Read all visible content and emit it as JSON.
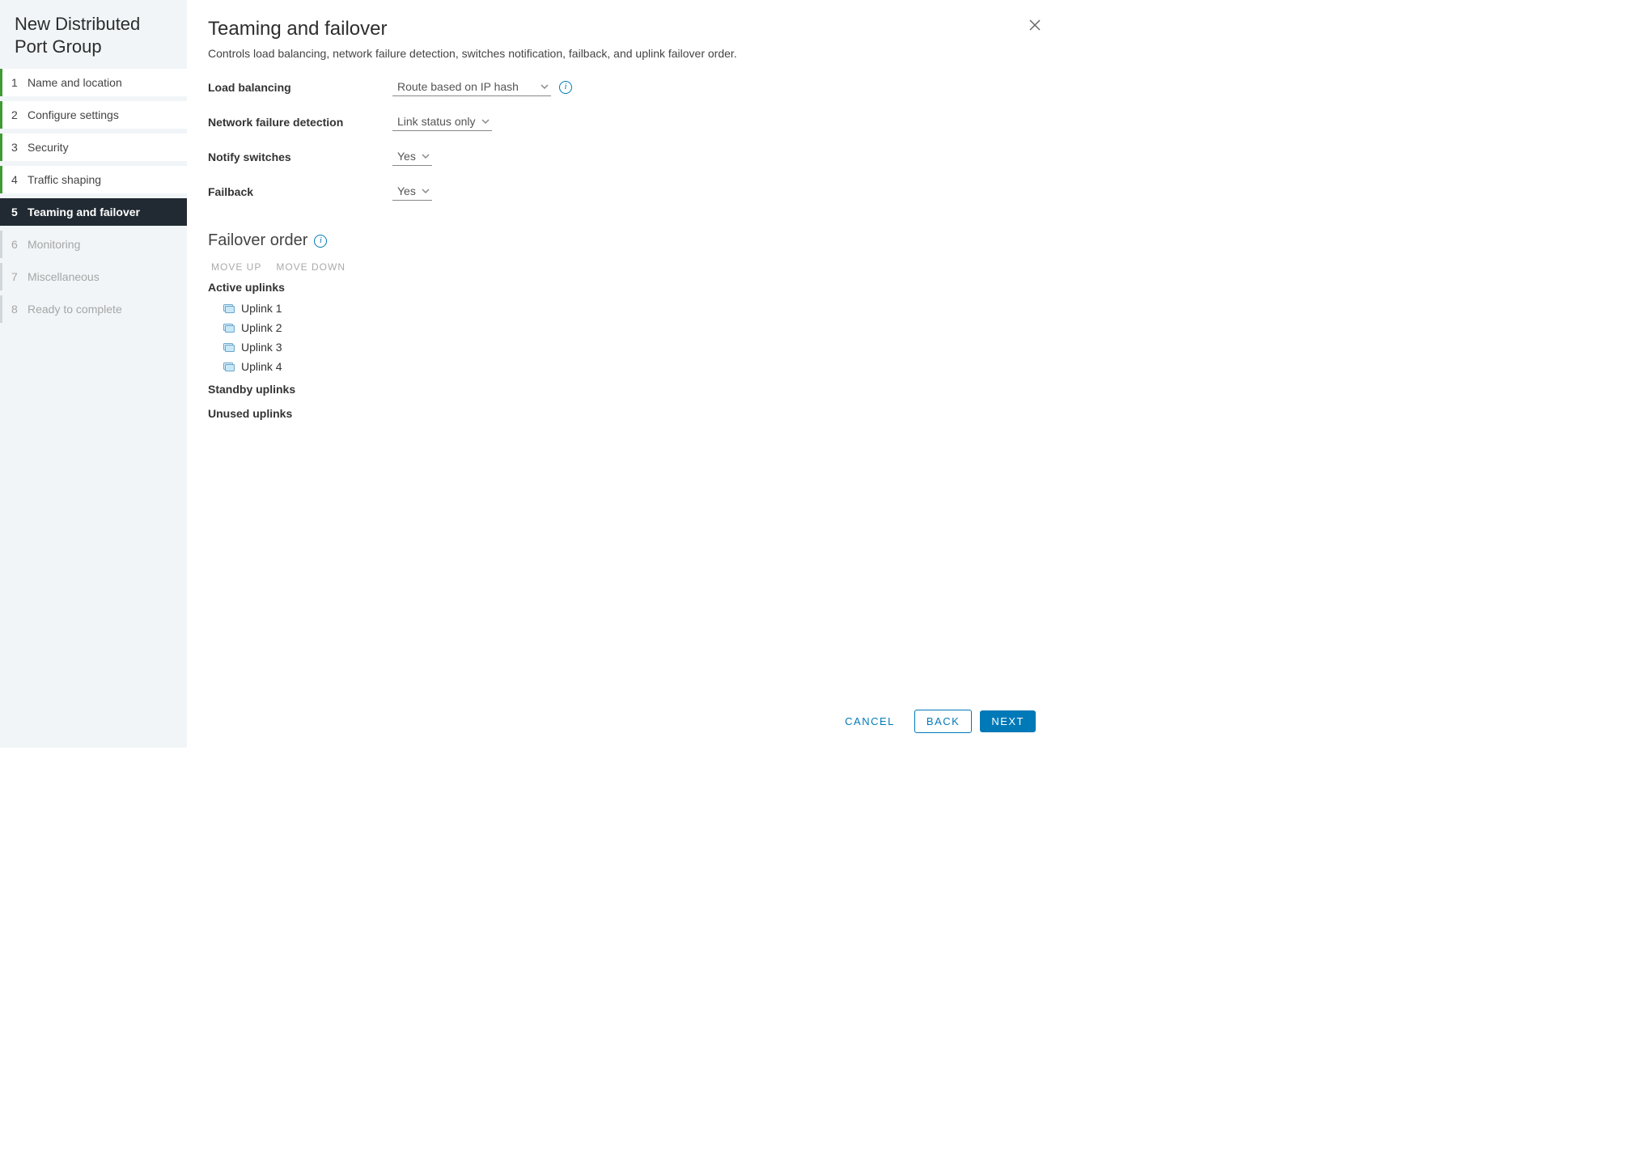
{
  "wizard": {
    "title": "New Distributed Port Group",
    "steps": [
      {
        "num": "1",
        "label": "Name and location",
        "state": "done"
      },
      {
        "num": "2",
        "label": "Configure settings",
        "state": "done"
      },
      {
        "num": "3",
        "label": "Security",
        "state": "done"
      },
      {
        "num": "4",
        "label": "Traffic shaping",
        "state": "done"
      },
      {
        "num": "5",
        "label": "Teaming and failover",
        "state": "active"
      },
      {
        "num": "6",
        "label": "Monitoring",
        "state": "disabled"
      },
      {
        "num": "7",
        "label": "Miscellaneous",
        "state": "disabled"
      },
      {
        "num": "8",
        "label": "Ready to complete",
        "state": "disabled"
      }
    ]
  },
  "page": {
    "title": "Teaming and failover",
    "description": "Controls load balancing, network failure detection, switches notification, failback, and uplink failover order."
  },
  "fields": {
    "load_balancing": {
      "label": "Load balancing",
      "value": "Route based on IP hash"
    },
    "network_failure_detection": {
      "label": "Network failure detection",
      "value": "Link status only"
    },
    "notify_switches": {
      "label": "Notify switches",
      "value": "Yes"
    },
    "failback": {
      "label": "Failback",
      "value": "Yes"
    }
  },
  "failover": {
    "title": "Failover order",
    "move_up": "MOVE UP",
    "move_down": "MOVE DOWN",
    "groups": {
      "active": {
        "title": "Active uplinks",
        "items": [
          "Uplink 1",
          "Uplink 2",
          "Uplink 3",
          "Uplink 4"
        ]
      },
      "standby": {
        "title": "Standby uplinks",
        "items": []
      },
      "unused": {
        "title": "Unused uplinks",
        "items": []
      }
    }
  },
  "footer": {
    "cancel": "CANCEL",
    "back": "BACK",
    "next": "NEXT"
  }
}
